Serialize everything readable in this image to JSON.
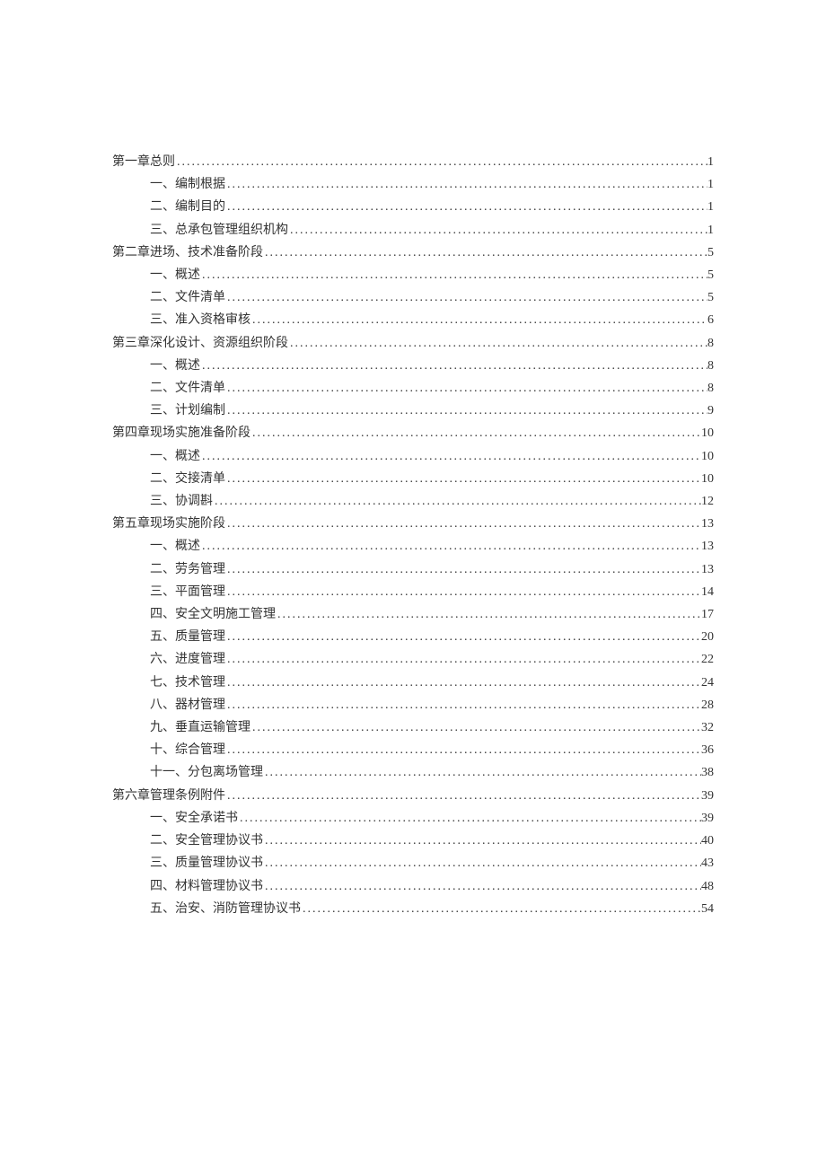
{
  "toc": [
    {
      "level": 1,
      "label": "第一章总则",
      "page": "1"
    },
    {
      "level": 2,
      "label": "一、编制根据",
      "page": "1"
    },
    {
      "level": 2,
      "label": "二、编制目的",
      "page": "1"
    },
    {
      "level": 2,
      "label": "三、总承包管理组织机构",
      "page": "1"
    },
    {
      "level": 1,
      "label": "第二章进场、技术准备阶段",
      "page": "5"
    },
    {
      "level": 2,
      "label": "一、概述",
      "page": "5"
    },
    {
      "level": 2,
      "label": "二、文件清单",
      "page": "5"
    },
    {
      "level": 2,
      "label": "三、准入资格审核",
      "page": "6"
    },
    {
      "level": 1,
      "label": "第三章深化设计、资源组织阶段",
      "page": "8"
    },
    {
      "level": 2,
      "label": "一、概述",
      "page": "8"
    },
    {
      "level": 2,
      "label": "二、文件清单",
      "page": "8"
    },
    {
      "level": 2,
      "label": "三、计划编制",
      "page": "9"
    },
    {
      "level": 1,
      "label": "第四章现场实施准备阶段",
      "page": "10"
    },
    {
      "level": 2,
      "label": "一、概述",
      "page": "10"
    },
    {
      "level": 2,
      "label": "二、交接清单",
      "page": "10"
    },
    {
      "level": 2,
      "label": "三、协调斟",
      "page": "12"
    },
    {
      "level": 1,
      "label": "第五章现场实施阶段",
      "page": "13"
    },
    {
      "level": 2,
      "label": "一、概述",
      "page": "13"
    },
    {
      "level": 2,
      "label": "二、劳务管理",
      "page": "13"
    },
    {
      "level": 2,
      "label": "三、平面管理",
      "page": "14"
    },
    {
      "level": 2,
      "label": "四、安全文明施工管理",
      "page": "17"
    },
    {
      "level": 2,
      "label": "五、质量管理",
      "page": "20"
    },
    {
      "level": 2,
      "label": "六、进度管理",
      "page": "22"
    },
    {
      "level": 2,
      "label": "七、技术管理",
      "page": "24"
    },
    {
      "level": 2,
      "label": "八、器材管理",
      "page": "28"
    },
    {
      "level": 2,
      "label": "九、垂直运输管理",
      "page": "32"
    },
    {
      "level": 2,
      "label": "十、综合管理",
      "page": "36"
    },
    {
      "level": 2,
      "label": "十一、分包离场管理",
      "page": "38"
    },
    {
      "level": 1,
      "label": "第六章管理条例附件",
      "page": "39"
    },
    {
      "level": 2,
      "label": "一、安全承诺书",
      "page": "39"
    },
    {
      "level": 2,
      "label": "二、安全管理协议书",
      "page": "40"
    },
    {
      "level": 2,
      "label": "三、质量管理协议书",
      "page": "43"
    },
    {
      "level": 2,
      "label": "四、材料管理协议书",
      "page": "48"
    },
    {
      "level": 2,
      "label": "五、治安、消防管理协议书",
      "page": "54"
    }
  ]
}
